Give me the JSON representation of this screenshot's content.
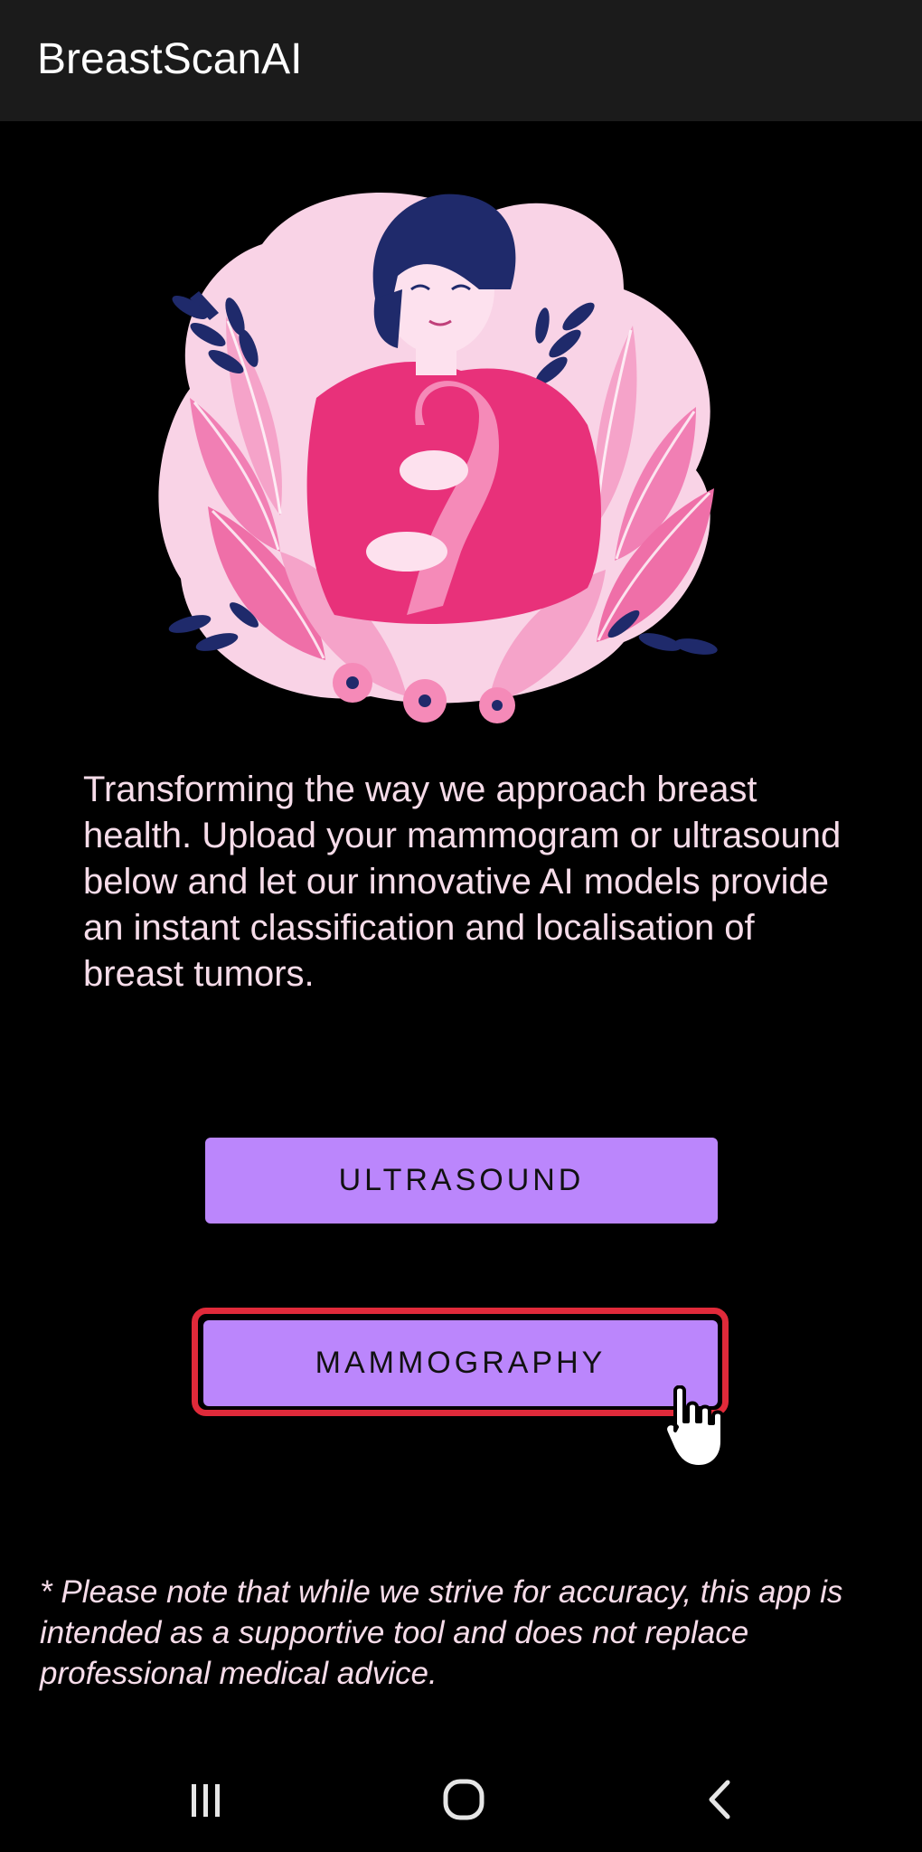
{
  "app_bar": {
    "title": "BreastScanAI"
  },
  "hero": {
    "icon": "breast-cancer-awareness-illustration"
  },
  "intro": {
    "text": "Transforming the way we approach breast health. Upload your mammogram or ultrasound below and let our innovative AI models provide an instant classification and localisation of breast tumors."
  },
  "buttons": {
    "ultrasound_label": "ULTRASOUND",
    "mammography_label": "MAMMOGRAPHY"
  },
  "disclaimer": {
    "text": "* Please note that while we strive for accuracy, this app is intended as a supportive tool and does not replace professional medical advice."
  },
  "nav_bar": {
    "recents_icon": "recents-icon",
    "home_icon": "home-icon",
    "back_icon": "back-icon"
  },
  "colors": {
    "app_bar_bg": "#1b1b1b",
    "background": "#000000",
    "button_bg": "#bb86fc",
    "highlight": "#e02a3a",
    "body_text": "#f6dce9"
  }
}
